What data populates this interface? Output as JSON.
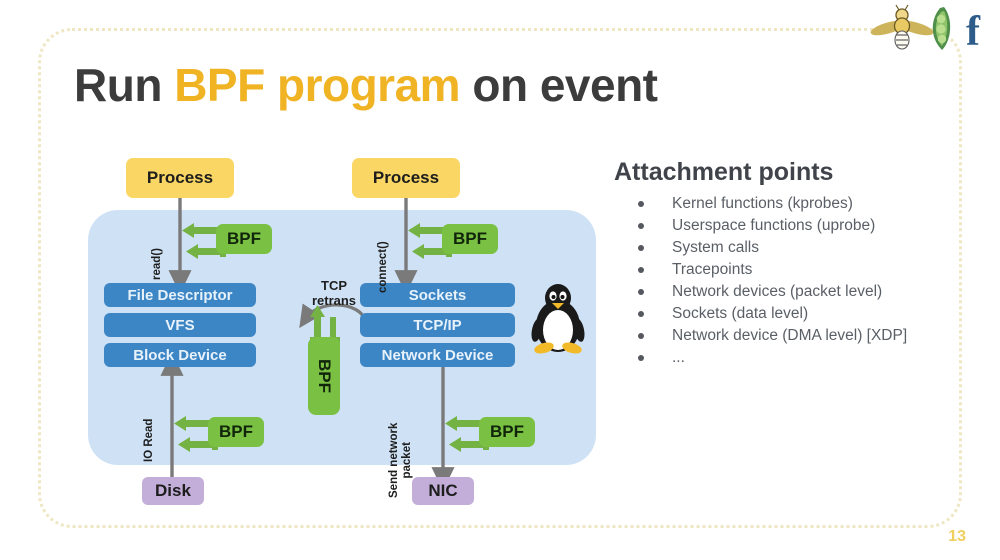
{
  "slide": {
    "page_number": "13",
    "title_prefix": "Run ",
    "title_accent": "BPF program",
    "title_suffix": " on event",
    "accent_color": "#f0b323",
    "title_color": "#3c3c3c"
  },
  "logo": {
    "bee_icon": "bee-icon",
    "pea_icon": "pea-pod-icon",
    "letter": "f",
    "letter_color": "#2e5c8a"
  },
  "attachment_points": {
    "heading": "Attachment points",
    "items": [
      "Kernel functions (kprobes)",
      "Userspace functions (uprobe)",
      "System calls",
      "Tracepoints",
      "Network devices (packet level)",
      "Sockets (data level)",
      "Network device (DMA level) [XDP]",
      "..."
    ]
  },
  "diagram": {
    "kernel_panel_color": "#cfe2f5",
    "process_left": "Process",
    "process_right": "Process",
    "kernel_boxes_left": [
      "File Descriptor",
      "VFS",
      "Block Device"
    ],
    "kernel_boxes_right": [
      "Sockets",
      "TCP/IP",
      "Network Device"
    ],
    "hardware_left": "Disk",
    "hardware_right": "NIC",
    "bpf_label": "BPF",
    "bpf_hooks": [
      {
        "id": "bpf-read",
        "label": "BPF",
        "orientation": "horizontal"
      },
      {
        "id": "bpf-connect",
        "label": "BPF",
        "orientation": "horizontal"
      },
      {
        "id": "bpf-io-read",
        "label": "BPF",
        "orientation": "horizontal"
      },
      {
        "id": "bpf-send-packet",
        "label": "BPF",
        "orientation": "horizontal"
      },
      {
        "id": "bpf-tcp-retrans",
        "label": "BPF",
        "orientation": "vertical"
      }
    ],
    "edge_labels": {
      "read": "read()",
      "connect": "connect()",
      "io_read": "IO Read",
      "send_packet_line1": "Send network",
      "send_packet_line2": "packet",
      "tcp_retrans_line1": "TCP",
      "tcp_retrans_line2": "retrans"
    },
    "tux_icon": "linux-penguin-icon",
    "colors": {
      "process": "#fad664",
      "kernel_box": "#3d86c6",
      "bpf": "#7ac043",
      "hardware": "#c2aed8",
      "arrow": "#7a7a7a"
    }
  }
}
